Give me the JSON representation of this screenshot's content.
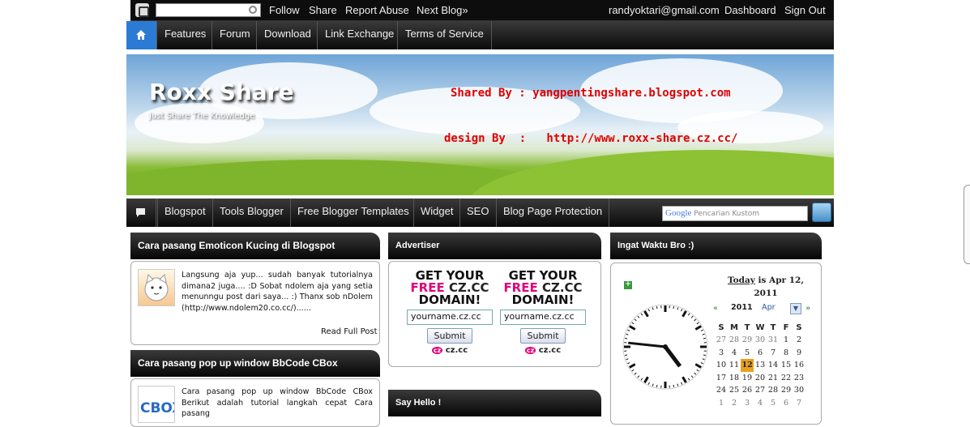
{
  "navbar": {
    "links": [
      "Follow",
      "Share",
      "Report Abuse",
      "Next Blog»"
    ],
    "user_email": "randyoktari@gmail.com",
    "dashboard": "Dashboard",
    "sign_out": "Sign Out"
  },
  "top_menu": [
    "Features",
    "Forum",
    "Download",
    "Link Exchange",
    "Terms of Service"
  ],
  "header": {
    "title": "Roxx Share",
    "description": "Just Share The Knowledge",
    "shared_by": "Shared By : yangpentingshare.blogspot.com",
    "design_by": "design By  :   http://www.roxx-share.cz.cc/"
  },
  "menu2": [
    "Blogspot",
    "Tools Blogger",
    "Free Blogger Templates",
    "Widget",
    "SEO",
    "Blog Page Protection"
  ],
  "search": {
    "brand": "Google",
    "placeholder": "Pencarian Kustom"
  },
  "posts": [
    {
      "title": "Cara pasang Emoticon Kucing di Blogspot",
      "excerpt": "Langsung aja yup... sudah banyak tutorialnya dimana2 juga.... :D Sobat ndolem aja yang setia menunngu post dari saya... :) Thanx sob nDolem (http://www.ndolem20.co.cc/)......",
      "read_more": "Read Full Post"
    },
    {
      "title": "Cara pasang pop up window BbCode CBox",
      "excerpt": "Cara pasang pop up window BbCode CBox Berikut adalah tutorial langkah cepat Cara pasang"
    }
  ],
  "advertiser": {
    "title": "Advertiser",
    "ads": [
      {
        "l1": "GET YOUR",
        "free": "FREE",
        "l2rest": " CZ.CC",
        "l3": "DOMAIN!",
        "input": "yourname.cz.cc",
        "button": "Submit",
        "logo": "cz.cc"
      },
      {
        "l1": "GET YOUR",
        "free": "FREE",
        "l2rest": " CZ.CC",
        "l3": "DOMAIN!",
        "input": "yourname.cz.cc",
        "button": "Submit",
        "logo": "cz.cc"
      }
    ]
  },
  "say_hello_title": "Say Hello !",
  "clock_widget": {
    "title": "Ingat Waktu Bro :)",
    "today_label": "Today",
    "today_text": " is Apr 12, 2011",
    "year": "2011",
    "month": "Apr",
    "weekdays": [
      "S",
      "M",
      "T",
      "W",
      "T",
      "F",
      "S"
    ],
    "weeks": [
      [
        "27",
        "28",
        "29",
        "30",
        "31",
        "1",
        "2"
      ],
      [
        "3",
        "4",
        "5",
        "6",
        "7",
        "8",
        "9"
      ],
      [
        "10",
        "11",
        "12",
        "13",
        "14",
        "15",
        "16"
      ],
      [
        "17",
        "18",
        "19",
        "20",
        "21",
        "22",
        "23"
      ],
      [
        "24",
        "25",
        "26",
        "27",
        "28",
        "29",
        "30"
      ],
      [
        "1",
        "2",
        "3",
        "4",
        "5",
        "6",
        "7"
      ]
    ],
    "today_day": "12",
    "clock": {
      "hour": 4,
      "minute": 46
    }
  }
}
